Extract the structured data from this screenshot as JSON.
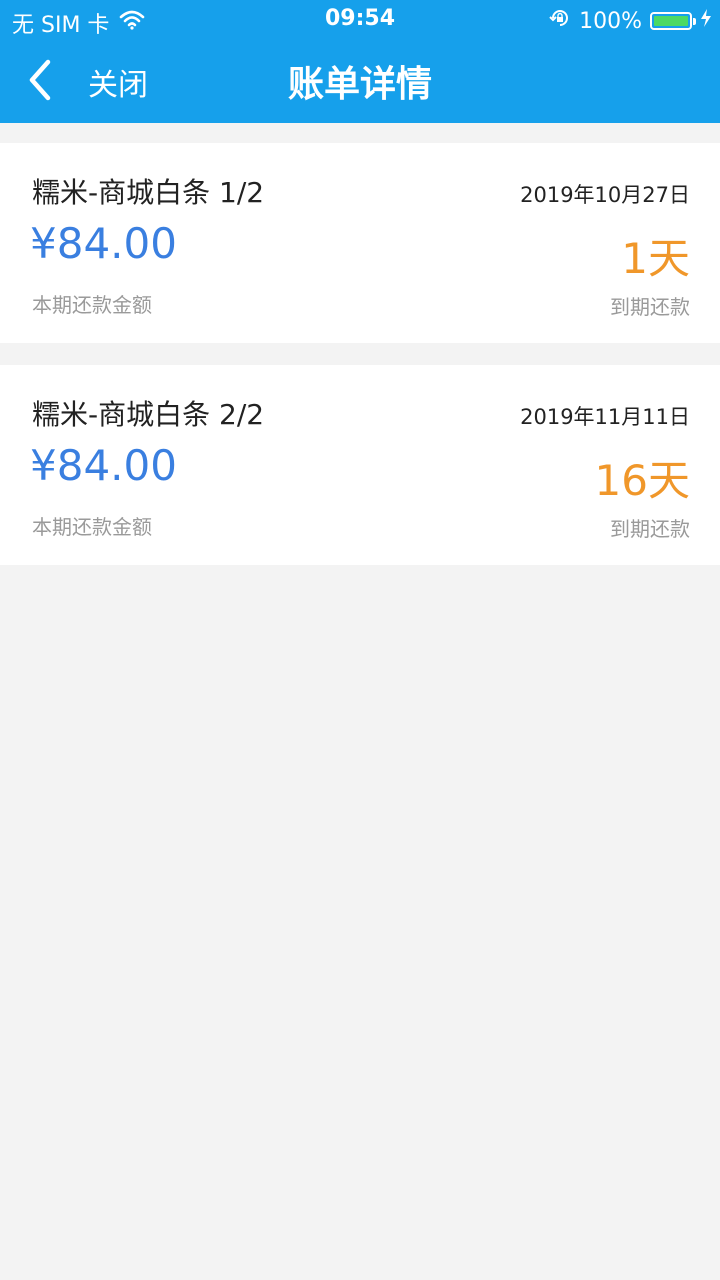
{
  "status_bar": {
    "carrier": "无 SIM 卡",
    "time": "09:54",
    "battery": "100%"
  },
  "nav": {
    "close_label": "关闭",
    "title": "账单详情"
  },
  "bills": [
    {
      "title": "糯米-商城白条 1/2",
      "date": "2019年10月27日",
      "amount": "¥84.00",
      "amount_label": "本期还款金额",
      "days": "1天",
      "due_label": "到期还款"
    },
    {
      "title": "糯米-商城白条 2/2",
      "date": "2019年11月11日",
      "amount": "¥84.00",
      "amount_label": "本期还款金额",
      "days": "16天",
      "due_label": "到期还款"
    }
  ],
  "colors": {
    "header": "#16a0eb",
    "amount": "#3a7fe0",
    "days": "#f0972a",
    "background": "#f3f3f3"
  }
}
